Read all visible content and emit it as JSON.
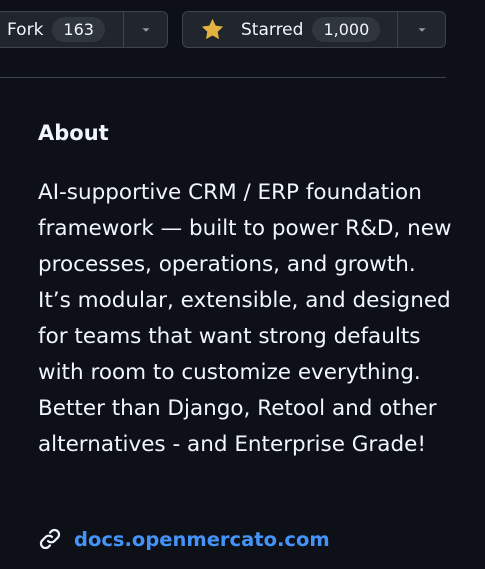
{
  "repo_actions": {
    "fork": {
      "label": "Fork",
      "count": "163"
    },
    "star": {
      "label": "Starred",
      "count": "1,000",
      "icon": "star-icon",
      "icon_color": "#e3b341"
    }
  },
  "about": {
    "heading": "About",
    "description": "AI-supportive CRM / ERP foundation framework — built to power R&D, new processes, operations, and growth. It’s modular, extensible, and designed for teams that want strong defaults with room to customize everything. Better than Django, Retool and other alternatives - and Enterprise Grade!",
    "website": {
      "icon": "link-icon",
      "text": "docs.openmercato.com",
      "color": "#4493f8"
    }
  }
}
